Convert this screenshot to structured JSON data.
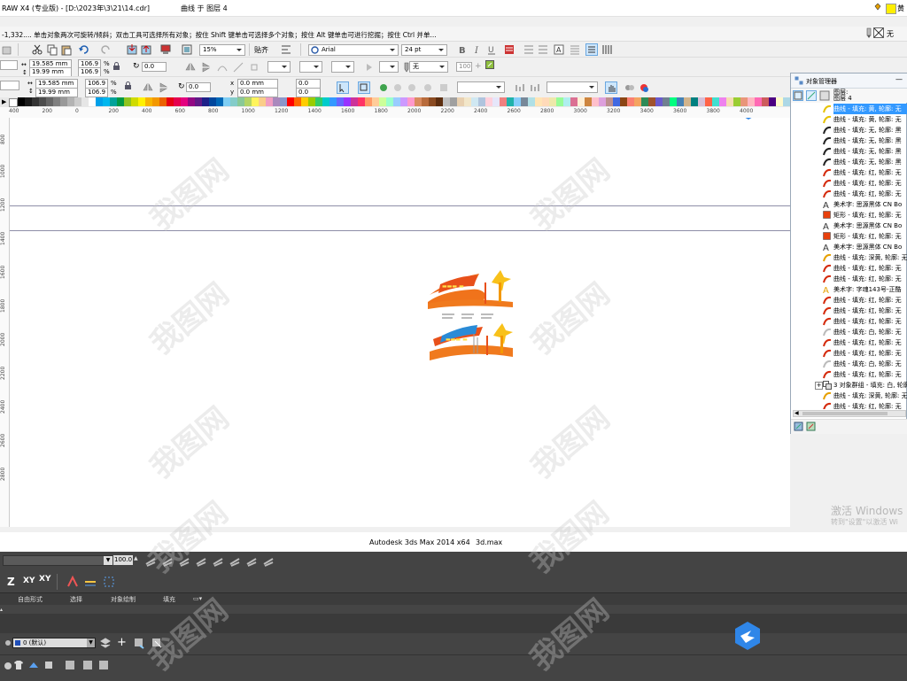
{
  "window": {
    "title": "RAW X4 (专业版) - [D:\\2023年\\3\\21\\14.cdr]",
    "center_title": "曲线 于 图层 4",
    "right_fill_label": "黄",
    "right_outline_label": "无",
    "fill_color": "#ffee00"
  },
  "hintbar": {
    "text": "-1,332.... 单击对象两次可旋转/倾斜；双击工具可选择所有对象；按住 Shift 键单击可选择多个对象；按住 Alt 键单击可进行挖掘；按住 Ctrl 并单..."
  },
  "toolbar1": {
    "zoom": "15%",
    "snap": "贴齐",
    "font": "Arial",
    "font_size": "24 pt"
  },
  "propbar1": {
    "width": "19.585 mm",
    "height": "19.99 mm",
    "scale_x": "106.9",
    "scale_y": "106.9",
    "pct": "%",
    "rotation": "0.0",
    "outline": "无",
    "opacity": "100"
  },
  "propbar2": {
    "width": "19.585 mm",
    "height": "19.99 mm",
    "scale_x": "106.9",
    "scale_y": "106.9",
    "pct": "%",
    "rotation": "0.0",
    "pos_x": "0.0 mm",
    "pos_y": "0.0 mm",
    "angle_a": "0.0",
    "angle_b": "0.0"
  },
  "palette": {
    "colors": [
      "#000000",
      "#1a1a1a",
      "#333333",
      "#4d4d4d",
      "#666666",
      "#808080",
      "#999999",
      "#b3b3b3",
      "#cccccc",
      "#e6e6e6",
      "#ffffff",
      "#00a0e9",
      "#00b7ee",
      "#00a29a",
      "#009944",
      "#8fc31f",
      "#cfdb00",
      "#fff100",
      "#f8b500",
      "#f39800",
      "#eb6100",
      "#e60012",
      "#e5004f",
      "#e4007f",
      "#920783",
      "#601986",
      "#1d2088",
      "#00479d",
      "#0068b7",
      "#7ecef4",
      "#84ccc9",
      "#89c997",
      "#b3d465",
      "#fff45c",
      "#facd89",
      "#f19ec2",
      "#aa89bd",
      "#8c97cb",
      "#ff0000",
      "#ff6600",
      "#ffcc00",
      "#99cc00",
      "#33cc66",
      "#00cccc",
      "#3399ff",
      "#6666ff",
      "#9933ff",
      "#cc3399",
      "#ff3366",
      "#ff9966",
      "#ffcc99",
      "#ccff99",
      "#99ffcc",
      "#99ccff",
      "#cc99ff",
      "#ff99cc",
      "#d98b5f",
      "#b86b3b",
      "#8a4b22",
      "#5c2e10",
      "#c0c0c0",
      "#a0a0a0",
      "#e8d0b0",
      "#f2e6c9",
      "#d0e8f2",
      "#b0c4de",
      "#ffd1dc",
      "#e6e6fa",
      "#f08080",
      "#20b2aa",
      "#87cefa",
      "#778899",
      "#b0e0e6",
      "#ffe4b5",
      "#ffdab9",
      "#eee8aa",
      "#98fb98",
      "#afeeee",
      "#db7093",
      "#ffefd5",
      "#cd853f",
      "#ffc0cb",
      "#dda0dd",
      "#bc8f8f",
      "#4169e1",
      "#8b4513",
      "#fa8072",
      "#f4a460",
      "#2e8b57",
      "#a0522d",
      "#6a5acd",
      "#708090",
      "#00ff7f",
      "#4682b4",
      "#d2b48c",
      "#008080",
      "#d8bfd8",
      "#ff6347",
      "#40e0d0",
      "#ee82ee",
      "#f5deb3",
      "#9acd32",
      "#e9967a",
      "#ffb6c1",
      "#ff69b4",
      "#cd5c5c",
      "#4b0082",
      "#fffacd",
      "#add8e6"
    ]
  },
  "ruler": {
    "ticks": [
      "400",
      "200",
      "0",
      "200",
      "400",
      "600",
      "800",
      "1000",
      "1200",
      "1400",
      "1600",
      "1800",
      "2000",
      "2200",
      "2400",
      "2600",
      "2800",
      "3000",
      "3200",
      "3400",
      "3600",
      "3800",
      "4000"
    ],
    "vticks": [
      "800",
      "1000",
      "1200",
      "1400",
      "1600",
      "1800",
      "2000",
      "2200",
      "2400",
      "2600",
      "2800"
    ]
  },
  "object_manager": {
    "title": "对象管理器",
    "layer_label1": "图层:",
    "layer_label2": "图层 4",
    "items": [
      {
        "label": "曲线 - 填充: 黄, 轮廓: 无",
        "icon": "curve-icon",
        "color": "#e6c200",
        "selected": true
      },
      {
        "label": "曲线 - 填充: 黄, 轮廓: 无",
        "icon": "curve-icon",
        "color": "#e6c200"
      },
      {
        "label": "曲线 - 填充: 无, 轮廓: 黑",
        "icon": "curve-icon",
        "color": "#222222"
      },
      {
        "label": "曲线 - 填充: 无, 轮廓: 黑",
        "icon": "curve-icon",
        "color": "#222222"
      },
      {
        "label": "曲线 - 填充: 无, 轮廓: 黑",
        "icon": "curve-icon",
        "color": "#222222"
      },
      {
        "label": "曲线 - 填充: 无, 轮廓: 黑",
        "icon": "curve-icon",
        "color": "#222222"
      },
      {
        "label": "曲线 - 填充: 红, 轮廓: 无",
        "icon": "curve-icon",
        "color": "#d42a0c"
      },
      {
        "label": "曲线 - 填充: 红, 轮廓: 无",
        "icon": "curve-icon",
        "color": "#d42a0c"
      },
      {
        "label": "曲线 - 填充: 红, 轮廓: 无",
        "icon": "curve-icon",
        "color": "#d42a0c"
      },
      {
        "label": "美术字: 思源黑体 CN Bo",
        "icon": "text-icon",
        "color": "#333333"
      },
      {
        "label": "矩形 - 填充: 红, 轮廓: 无",
        "icon": "rect-icon",
        "color": "#e8400c"
      },
      {
        "label": "美术字: 思源黑体 CN Bo",
        "icon": "text-icon",
        "color": "#333333"
      },
      {
        "label": "矩形 - 填充: 红, 轮廓: 无",
        "icon": "rect-icon",
        "color": "#e8400c"
      },
      {
        "label": "美术字: 思源黑体 CN Bo",
        "icon": "text-icon",
        "color": "#333333"
      },
      {
        "label": "曲线 - 填充: 深黄, 轮廓: 无",
        "icon": "curve-icon",
        "color": "#e6a000"
      },
      {
        "label": "曲线 - 填充: 红, 轮廓: 无",
        "icon": "curve-icon",
        "color": "#d42a0c"
      },
      {
        "label": "曲线 - 填充: 红, 轮廓: 无",
        "icon": "curve-icon",
        "color": "#d42a0c"
      },
      {
        "label": "美术字: 字魂143号-正酷",
        "icon": "text-icon",
        "color": "#e6a000"
      },
      {
        "label": "曲线 - 填充: 红, 轮廓: 无",
        "icon": "curve-icon",
        "color": "#d42a0c"
      },
      {
        "label": "曲线 - 填充: 红, 轮廓: 无",
        "icon": "curve-icon",
        "color": "#d42a0c"
      },
      {
        "label": "曲线 - 填充: 红, 轮廓: 无",
        "icon": "curve-icon",
        "color": "#d42a0c"
      },
      {
        "label": "曲线 - 填充: 白, 轮廓: 无",
        "icon": "curve-icon",
        "color": "#bbbbbb"
      },
      {
        "label": "曲线 - 填充: 红, 轮廓: 无",
        "icon": "curve-icon",
        "color": "#d42a0c"
      },
      {
        "label": "曲线 - 填充: 红, 轮廓: 无",
        "icon": "curve-icon",
        "color": "#d42a0c"
      },
      {
        "label": "曲线 - 填充: 白, 轮廓: 无",
        "icon": "curve-icon",
        "color": "#bbbbbb"
      },
      {
        "label": "曲线 - 填充: 红, 轮廓: 无",
        "icon": "curve-icon",
        "color": "#d42a0c"
      },
      {
        "label": "3 对象群组 - 填充: 白, 轮廓",
        "icon": "group-icon",
        "color": "#666666",
        "group": true
      },
      {
        "label": "曲线 - 填充: 深黄, 轮廓: 无",
        "icon": "curve-icon",
        "color": "#e6a000"
      },
      {
        "label": "曲线 - 填充: 红, 轮廓: 无",
        "icon": "curve-icon",
        "color": "#d42a0c"
      },
      {
        "label": "曲线 - 填充: 红, 轮廓: 无",
        "icon": "curve-icon",
        "color": "#d42a0c"
      }
    ]
  },
  "activation": {
    "line1": "激活 Windows",
    "line2": "转到\"设置\"以激活 Wi"
  },
  "max": {
    "title": "Autodesk 3ds Max  2014 x64",
    "file": "3d.max",
    "spinner": "100.0",
    "axis_z": "Z",
    "axis_xy": "XY",
    "axis_xy2": "XY",
    "ribbon_tabs": [
      "自由形式",
      "选择",
      "对象绘制",
      "填充"
    ],
    "layer": "0 (默认)"
  },
  "watermark": "我图网"
}
